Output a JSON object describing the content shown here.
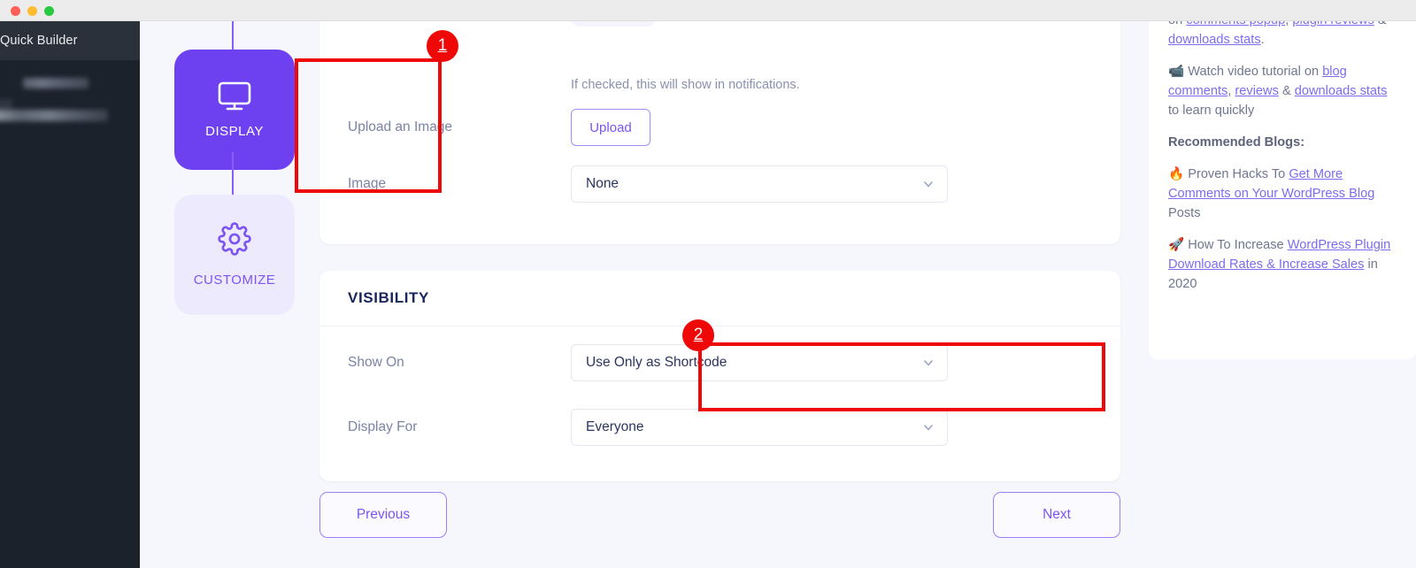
{
  "window": {
    "traffic_lights": [
      "close",
      "minimize",
      "maximize"
    ]
  },
  "sidebar": {
    "title": "Quick Builder",
    "blurred_items": [
      "redacted-item-1",
      "redacted-item-2"
    ]
  },
  "stepper": {
    "steps": [
      {
        "label": "DISPLAY",
        "icon": "monitor-icon",
        "state": "active"
      },
      {
        "label": "CUSTOMIZE",
        "icon": "gear-icon",
        "state": "inactive"
      }
    ]
  },
  "annotations": [
    {
      "number": "1",
      "target": "display-step-card"
    },
    {
      "number": "2",
      "target": "show-on-select"
    }
  ],
  "main": {
    "helper_text": "If checked, this will show in notifications.",
    "rows": [
      {
        "label": "Upload an Image",
        "control": "button",
        "value": "Upload"
      },
      {
        "label": "Image",
        "control": "select",
        "value": "None"
      }
    ],
    "visibility": {
      "heading": "VISIBILITY",
      "rows": [
        {
          "label": "Show On",
          "control": "select",
          "value": "Use Only as Shortcode"
        },
        {
          "label": "Display For",
          "control": "select",
          "value": "Everyone"
        }
      ]
    },
    "footer": {
      "previous_label": "Previous",
      "next_label": "Next"
    }
  },
  "help_panel": {
    "paragraph_1": {
      "prefix": "on ",
      "link_1": "comments popup",
      "sep_1": ", ",
      "link_2": "plugin reviews",
      "sep_2": " & ",
      "link_3": "downloads stats",
      "suffix": "."
    },
    "paragraph_2": {
      "icon": "video-icon",
      "prefix": " Watch video tutorial on ",
      "link_1": "blog comments",
      "sep_1": ", ",
      "link_2": "reviews",
      "sep_2": " & ",
      "link_3": "downloads stats",
      "suffix": " to learn quickly"
    },
    "heading": "Recommended Blogs:",
    "blog_1": {
      "icon": "fire-emoji",
      "prefix": " Proven Hacks To ",
      "link": "Get More Comments on Your WordPress Blog",
      "suffix": " Posts"
    },
    "blog_2": {
      "icon": "rocket-emoji",
      "prefix": " How To Increase ",
      "link": "WordPress Plugin Download Rates & Increase Sales",
      "suffix": " in 2020"
    }
  },
  "colors": {
    "accent_purple": "#6d40f0",
    "accent_purple_light": "#eeeafe",
    "annotation_red": "#ef0808",
    "link_purple": "#7b6cf0",
    "heading_navy": "#18255c",
    "page_bg": "#f6f7fc",
    "sidebar_dark": "#1c222c"
  }
}
